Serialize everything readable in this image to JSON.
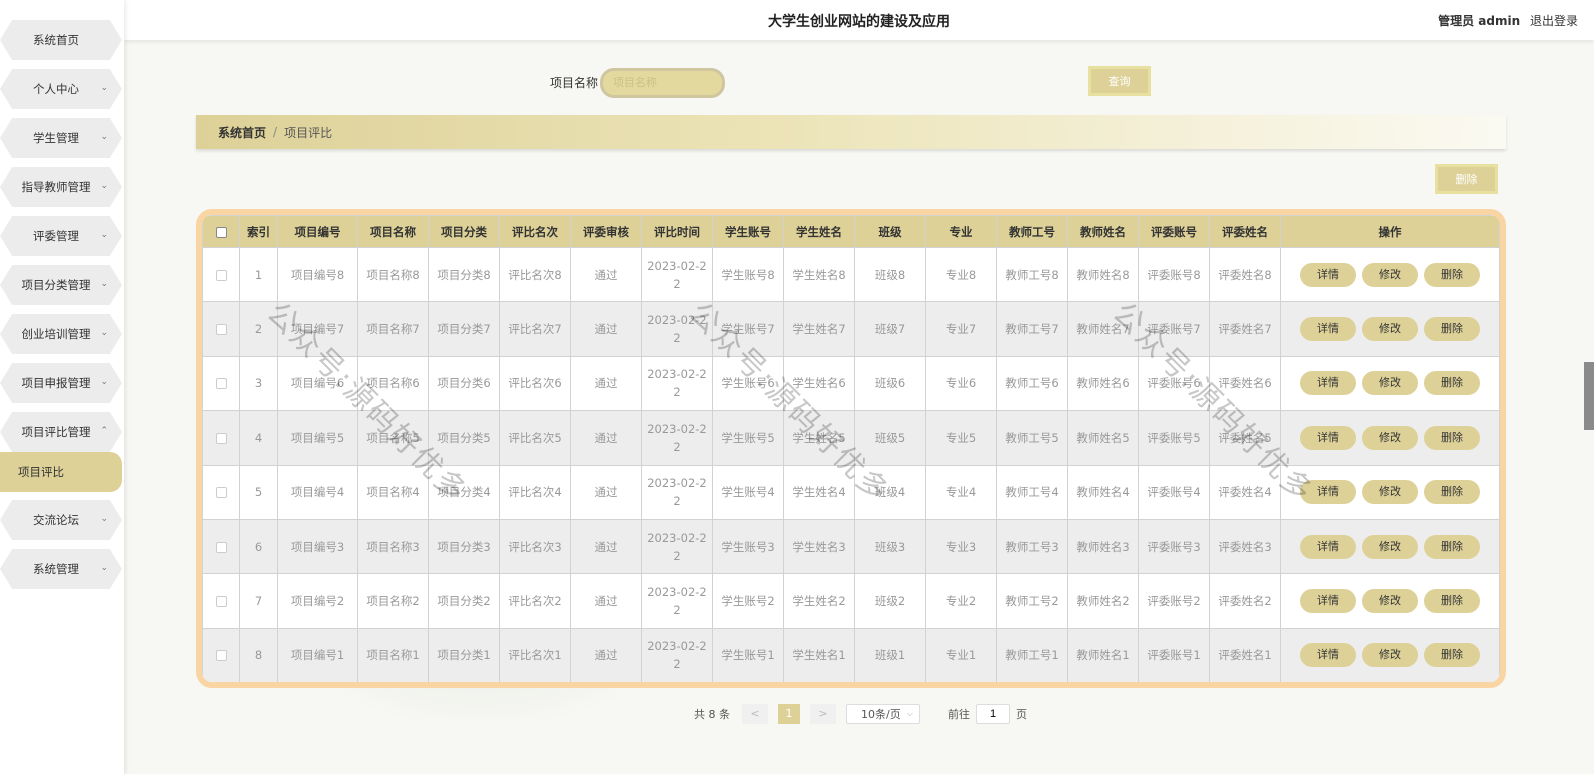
{
  "header": {
    "title": "大学生创业网站的建设及应用",
    "user_prefix": "管理员 admin",
    "logout": "退出登录"
  },
  "sidebar": {
    "items": [
      {
        "label": "系统首页",
        "chevron": ""
      },
      {
        "label": "个人中心",
        "chevron": "⌄"
      },
      {
        "label": "学生管理",
        "chevron": "⌄"
      },
      {
        "label": "指导教师管理",
        "chevron": "⌄"
      },
      {
        "label": "评委管理",
        "chevron": "⌄"
      },
      {
        "label": "项目分类管理",
        "chevron": "⌄"
      },
      {
        "label": "创业培训管理",
        "chevron": "⌄"
      },
      {
        "label": "项目申报管理",
        "chevron": "⌄"
      },
      {
        "label": "项目评比管理",
        "chevron": "⌃"
      },
      {
        "label": "项目评比",
        "chevron": ""
      },
      {
        "label": "交流论坛",
        "chevron": "⌄"
      },
      {
        "label": "系统管理",
        "chevron": "⌄"
      }
    ]
  },
  "search": {
    "label": "项目名称",
    "placeholder": "项目名称",
    "button": "查询"
  },
  "breadcrumb": {
    "home": "系统首页",
    "separator": "/",
    "current": "项目评比"
  },
  "toolbar": {
    "delete": "删除"
  },
  "table": {
    "columns": [
      "索引",
      "项目编号",
      "项目名称",
      "项目分类",
      "评比名次",
      "评委审核",
      "评比时间",
      "学生账号",
      "学生姓名",
      "班级",
      "专业",
      "教师工号",
      "教师姓名",
      "评委账号",
      "评委姓名",
      "操作"
    ],
    "actions": {
      "detail": "详情",
      "edit": "修改",
      "delete": "删除"
    },
    "rows": [
      {
        "idx": "1",
        "code": "项目编号8",
        "name": "项目名称8",
        "category": "项目分类8",
        "rank": "评比名次8",
        "review": "通过",
        "time": "2023-02-22",
        "stu_acc": "学生账号8",
        "stu_name": "学生姓名8",
        "class": "班级8",
        "major": "专业8",
        "tea_no": "教师工号8",
        "tea_name": "教师姓名8",
        "jud_acc": "评委账号8",
        "jud_name": "评委姓名8"
      },
      {
        "idx": "2",
        "code": "项目编号7",
        "name": "项目名称7",
        "category": "项目分类7",
        "rank": "评比名次7",
        "review": "通过",
        "time": "2023-02-22",
        "stu_acc": "学生账号7",
        "stu_name": "学生姓名7",
        "class": "班级7",
        "major": "专业7",
        "tea_no": "教师工号7",
        "tea_name": "教师姓名7",
        "jud_acc": "评委账号7",
        "jud_name": "评委姓名7"
      },
      {
        "idx": "3",
        "code": "项目编号6",
        "name": "项目名称6",
        "category": "项目分类6",
        "rank": "评比名次6",
        "review": "通过",
        "time": "2023-02-22",
        "stu_acc": "学生账号6",
        "stu_name": "学生姓名6",
        "class": "班级6",
        "major": "专业6",
        "tea_no": "教师工号6",
        "tea_name": "教师姓名6",
        "jud_acc": "评委账号6",
        "jud_name": "评委姓名6"
      },
      {
        "idx": "4",
        "code": "项目编号5",
        "name": "项目名称5",
        "category": "项目分类5",
        "rank": "评比名次5",
        "review": "通过",
        "time": "2023-02-22",
        "stu_acc": "学生账号5",
        "stu_name": "学生姓名5",
        "class": "班级5",
        "major": "专业5",
        "tea_no": "教师工号5",
        "tea_name": "教师姓名5",
        "jud_acc": "评委账号5",
        "jud_name": "评委姓名5"
      },
      {
        "idx": "5",
        "code": "项目编号4",
        "name": "项目名称4",
        "category": "项目分类4",
        "rank": "评比名次4",
        "review": "通过",
        "time": "2023-02-22",
        "stu_acc": "学生账号4",
        "stu_name": "学生姓名4",
        "class": "班级4",
        "major": "专业4",
        "tea_no": "教师工号4",
        "tea_name": "教师姓名4",
        "jud_acc": "评委账号4",
        "jud_name": "评委姓名4"
      },
      {
        "idx": "6",
        "code": "项目编号3",
        "name": "项目名称3",
        "category": "项目分类3",
        "rank": "评比名次3",
        "review": "通过",
        "time": "2023-02-22",
        "stu_acc": "学生账号3",
        "stu_name": "学生姓名3",
        "class": "班级3",
        "major": "专业3",
        "tea_no": "教师工号3",
        "tea_name": "教师姓名3",
        "jud_acc": "评委账号3",
        "jud_name": "评委姓名3"
      },
      {
        "idx": "7",
        "code": "项目编号2",
        "name": "项目名称2",
        "category": "项目分类2",
        "rank": "评比名次2",
        "review": "通过",
        "time": "2023-02-22",
        "stu_acc": "学生账号2",
        "stu_name": "学生姓名2",
        "class": "班级2",
        "major": "专业2",
        "tea_no": "教师工号2",
        "tea_name": "教师姓名2",
        "jud_acc": "评委账号2",
        "jud_name": "评委姓名2"
      },
      {
        "idx": "8",
        "code": "项目编号1",
        "name": "项目名称1",
        "category": "项目分类1",
        "rank": "评比名次1",
        "review": "通过",
        "time": "2023-02-22",
        "stu_acc": "学生账号1",
        "stu_name": "学生姓名1",
        "class": "班级1",
        "major": "专业1",
        "tea_no": "教师工号1",
        "tea_name": "教师姓名1",
        "jud_acc": "评委账号1",
        "jud_name": "评委姓名1"
      }
    ]
  },
  "pagination": {
    "total": "共 8 条",
    "prev": "<",
    "current_page": "1",
    "next": ">",
    "page_size": "10条/页",
    "goto_prefix": "前往",
    "goto_value": "1",
    "goto_suffix": "页"
  },
  "watermark": {
    "text": "公众号:源码好优多"
  },
  "colors": {
    "accent": "#ddd198",
    "table_border": "#f9d5a3",
    "row_alt": "#ededed"
  }
}
